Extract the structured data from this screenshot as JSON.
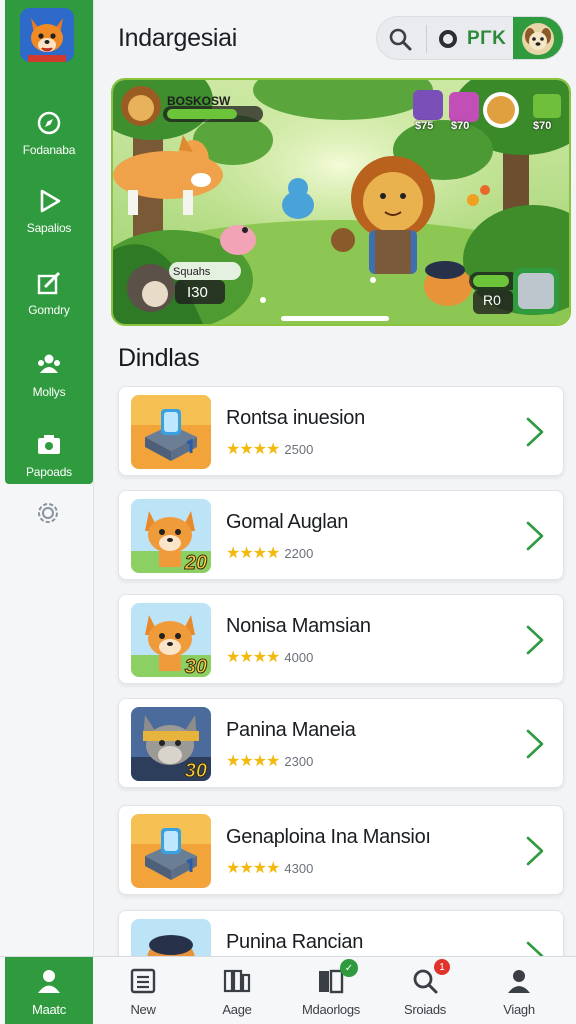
{
  "header": {
    "title": "Indargesiai",
    "pill_label": "PΓK"
  },
  "sidebar": {
    "items": [
      {
        "label": "Fodanaba",
        "icon": "compass-icon"
      },
      {
        "label": "Sapalios",
        "icon": "play-icon"
      },
      {
        "label": "Gomdry",
        "icon": "edit-icon"
      },
      {
        "label": "Mollys",
        "icon": "people-icon"
      },
      {
        "label": "Papoads",
        "icon": "camera-icon"
      }
    ]
  },
  "banner": {
    "boss_label": "BOSKOSW",
    "items": [
      {
        "price": "$75"
      },
      {
        "price": "$70"
      },
      {
        "price": "$70"
      }
    ],
    "player_name": "Squahs",
    "player_score": "I30",
    "enemy_score": "R0"
  },
  "section": {
    "title": "Dindlas"
  },
  "games": [
    {
      "name": "Rontsa inuesion",
      "stars": "★★★★",
      "count": "2500",
      "thumb": "cube-thumb",
      "thumb_badge": ""
    },
    {
      "name": "Gomal Auglan",
      "stars": "★★★★",
      "count": "2200",
      "thumb": "fox-thumb",
      "thumb_badge": "20"
    },
    {
      "name": "Nonisa Mamsian",
      "stars": "★★★★",
      "count": "4000",
      "thumb": "fox-thumb",
      "thumb_badge": "30"
    },
    {
      "name": "Panina Maneia",
      "stars": "★★★★",
      "count": "2300",
      "thumb": "wolf-thumb",
      "thumb_badge": "30"
    },
    {
      "name": "Genaploina Ina Mansioı",
      "stars": "★★★★",
      "count": "4300",
      "thumb": "cube-thumb",
      "thumb_badge": ""
    },
    {
      "name": "Punina Rancian",
      "stars": "",
      "count": "",
      "thumb": "raccoon-thumb",
      "thumb_badge": ""
    }
  ],
  "bottom_nav": {
    "items": [
      {
        "label": "Maatc",
        "icon": "person-icon"
      },
      {
        "label": "New",
        "icon": "list-icon"
      },
      {
        "label": "Aage",
        "icon": "apps-icon"
      },
      {
        "label": "Mdaorlogs",
        "icon": "library-icon",
        "badge": "✓"
      },
      {
        "label": "Sroiads",
        "icon": "search-icon",
        "badge": "1"
      },
      {
        "label": "Viagh",
        "icon": "profile-icon"
      }
    ]
  },
  "colors": {
    "brand_green": "#2f9a3e",
    "star_yellow": "#f2b90f",
    "badge_red": "#e0342b"
  }
}
